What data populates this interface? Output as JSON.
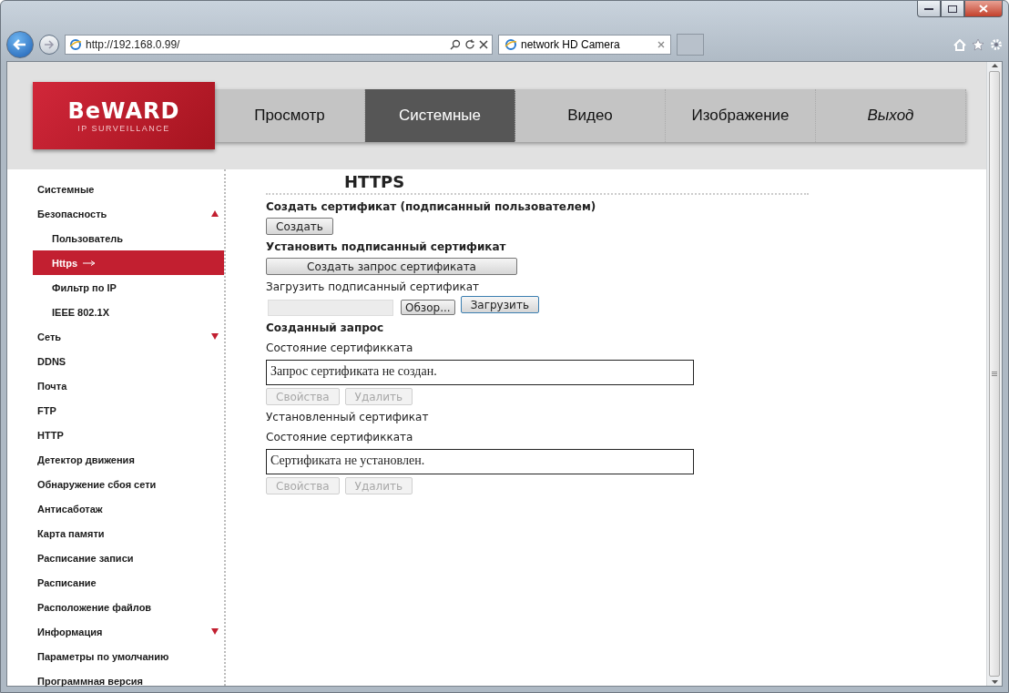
{
  "browser": {
    "address": "http://192.168.0.99/",
    "tabs": [
      {
        "title": "network HD Camera",
        "selected": true
      }
    ]
  },
  "header": {
    "logo": {
      "brand": "BeWARD",
      "tagline": "IP SURVEILLANCE"
    },
    "nav": [
      {
        "label": "Просмотр",
        "selected": false,
        "kind": "page"
      },
      {
        "label": "Системные",
        "selected": true,
        "kind": "page"
      },
      {
        "label": "Видео",
        "selected": false,
        "kind": "page"
      },
      {
        "label": "Изображение",
        "selected": false,
        "kind": "page"
      },
      {
        "label": "Выход",
        "selected": false,
        "kind": "exit"
      }
    ]
  },
  "sidebar": {
    "items": [
      {
        "label": "Системные",
        "selected": false
      },
      {
        "label": "Безопасность",
        "selected": false,
        "expanded": true,
        "children": [
          {
            "label": "Пользователь",
            "selected": false
          },
          {
            "label": "Https",
            "selected": true
          },
          {
            "label": "Фильтр по IP",
            "selected": false
          },
          {
            "label": "IEEE 802.1X",
            "selected": false
          }
        ]
      },
      {
        "label": "Сеть",
        "selected": false,
        "expanded": false
      },
      {
        "label": "DDNS",
        "selected": false
      },
      {
        "label": "Почта",
        "selected": false
      },
      {
        "label": "FTP",
        "selected": false
      },
      {
        "label": "HTTP",
        "selected": false
      },
      {
        "label": "Детектор движения",
        "selected": false
      },
      {
        "label": "Обнаружение сбоя сети",
        "selected": false
      },
      {
        "label": "Антисаботаж",
        "selected": false
      },
      {
        "label": "Карта памяти",
        "selected": false
      },
      {
        "label": "Расписание записи",
        "selected": false
      },
      {
        "label": "Расписание",
        "selected": false
      },
      {
        "label": "Расположение файлов",
        "selected": false
      },
      {
        "label": "Информация",
        "selected": false,
        "expanded": false
      },
      {
        "label": "Параметры по умолчанию",
        "selected": false
      },
      {
        "label": "Программная версия",
        "selected": false
      }
    ]
  },
  "content": {
    "title": "HTTPS",
    "blocks": [
      {
        "kind": "heading",
        "text": "Создать сертификат (подписанный пользователем)"
      },
      {
        "kind": "buttons",
        "buttons": [
          {
            "label": "Создать",
            "disabled": false
          }
        ]
      },
      {
        "kind": "heading",
        "text": "Установить подписанный сертификат"
      },
      {
        "kind": "wide-button",
        "label": "Создать запрос сертификата"
      },
      {
        "kind": "label",
        "text": "Загрузить подписанный сертификат"
      },
      {
        "kind": "upload",
        "browse": "Обзор...",
        "submit": "Загрузить"
      },
      {
        "kind": "heading",
        "text": "Созданный запрос"
      },
      {
        "kind": "label",
        "text": "Состояние сертификката"
      },
      {
        "kind": "status",
        "text": "Запрос сертификата не создан."
      },
      {
        "kind": "buttons",
        "buttons": [
          {
            "label": "Свойства",
            "disabled": true
          },
          {
            "label": "Удалить",
            "disabled": true
          }
        ]
      },
      {
        "kind": "label",
        "text": "Установленный сертификат"
      },
      {
        "kind": "label",
        "text": "Состояние сертификката"
      },
      {
        "kind": "status",
        "text": "Сертификата не установлен."
      },
      {
        "kind": "buttons",
        "buttons": [
          {
            "label": "Свойства",
            "disabled": true
          },
          {
            "label": "Удалить",
            "disabled": true
          }
        ]
      }
    ]
  }
}
